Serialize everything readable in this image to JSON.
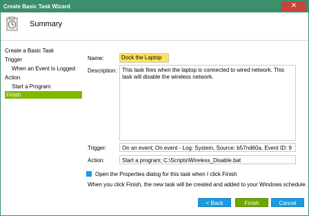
{
  "window": {
    "title": "Create Basic Task Wizard",
    "close_glyph": "✕"
  },
  "header": {
    "title": "Summary",
    "icon": "clock-task-icon"
  },
  "nav": {
    "items": [
      {
        "label": "Create a Basic Task"
      },
      {
        "label": "Trigger"
      },
      {
        "label": "When an Event Is Logged"
      },
      {
        "label": "Action"
      },
      {
        "label": "Start a Program"
      },
      {
        "label": "Finish"
      }
    ]
  },
  "form": {
    "name_label": "Name:",
    "name_value": "Dock the Laptop",
    "description_label": "Description:",
    "description_value": "This task fires when the laptop is connected to wired network. This task will disable the wireless network.",
    "trigger_label": "Trigger:",
    "trigger_value": "On an event; On event - Log: System, Source: b57nd60a, Event ID: 9",
    "action_label": "Action:",
    "action_value": "Start a program; C:\\Scripts\\Wireless_Disable.bat"
  },
  "options": {
    "open_properties_label": "Open the Properties dialog for this task when I click Finish",
    "note": "When you click Finish, the new task will be created and added to your Windows schedule."
  },
  "buttons": {
    "back": "< Back",
    "finish": "Finish",
    "cancel": "Cancel"
  },
  "colors": {
    "titlebar": "#3b8f6a",
    "selected_nav": "#7fb800",
    "accent_blue": "#1a9ae0",
    "finish_green": "#6ea600",
    "name_highlight": "#ffe15a"
  }
}
